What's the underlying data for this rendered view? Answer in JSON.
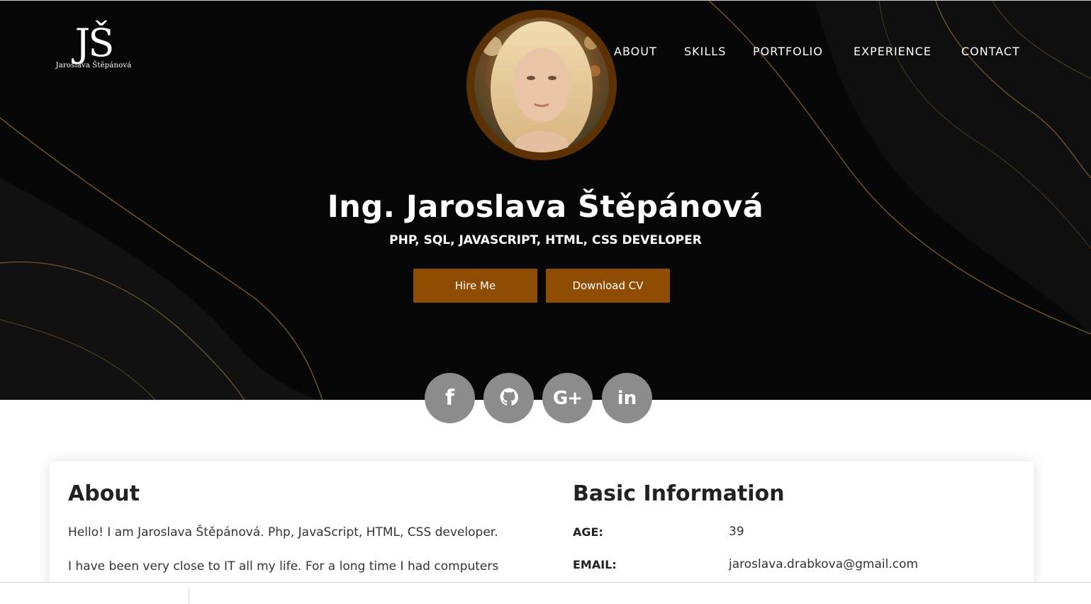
{
  "logo": {
    "mark": "JŠ",
    "name": "Jaroslava Štěpánová"
  },
  "nav": {
    "items": [
      {
        "label": "ABOUT"
      },
      {
        "label": "SKILLS"
      },
      {
        "label": "PORTFOLIO"
      },
      {
        "label": "EXPERIENCE"
      },
      {
        "label": "CONTACT"
      }
    ]
  },
  "hero": {
    "name": "Ing. Jaroslava Štěpánová",
    "subtitle": "PHP, SQL, JAVASCRIPT, HTML, CSS DEVELOPER",
    "hire_label": "Hire Me",
    "cv_label": "Download CV"
  },
  "social": [
    {
      "icon": "facebook-icon",
      "glyph": "f"
    },
    {
      "icon": "github-icon",
      "glyph": ""
    },
    {
      "icon": "google-plus-icon",
      "glyph": "G+"
    },
    {
      "icon": "linkedin-icon",
      "glyph": "in"
    }
  ],
  "about": {
    "heading": "About",
    "paragraphs": [
      "Hello! I am Jaroslava Štěpánová. Php, JavaScript, HTML, CSS developer.",
      "I have been very close to IT all my life. For a long time I had computers"
    ]
  },
  "basic_info": {
    "heading": "Basic Information",
    "rows": [
      {
        "label": "AGE:",
        "value": "39"
      },
      {
        "label": "EMAIL:",
        "value": "jaroslava.drabkova@gmail.com"
      }
    ]
  },
  "colors": {
    "accent": "#8f4c03",
    "avatar_ring": "#5c3205",
    "hero_bg": "#070707",
    "social_bg": "#8c8c8c"
  }
}
